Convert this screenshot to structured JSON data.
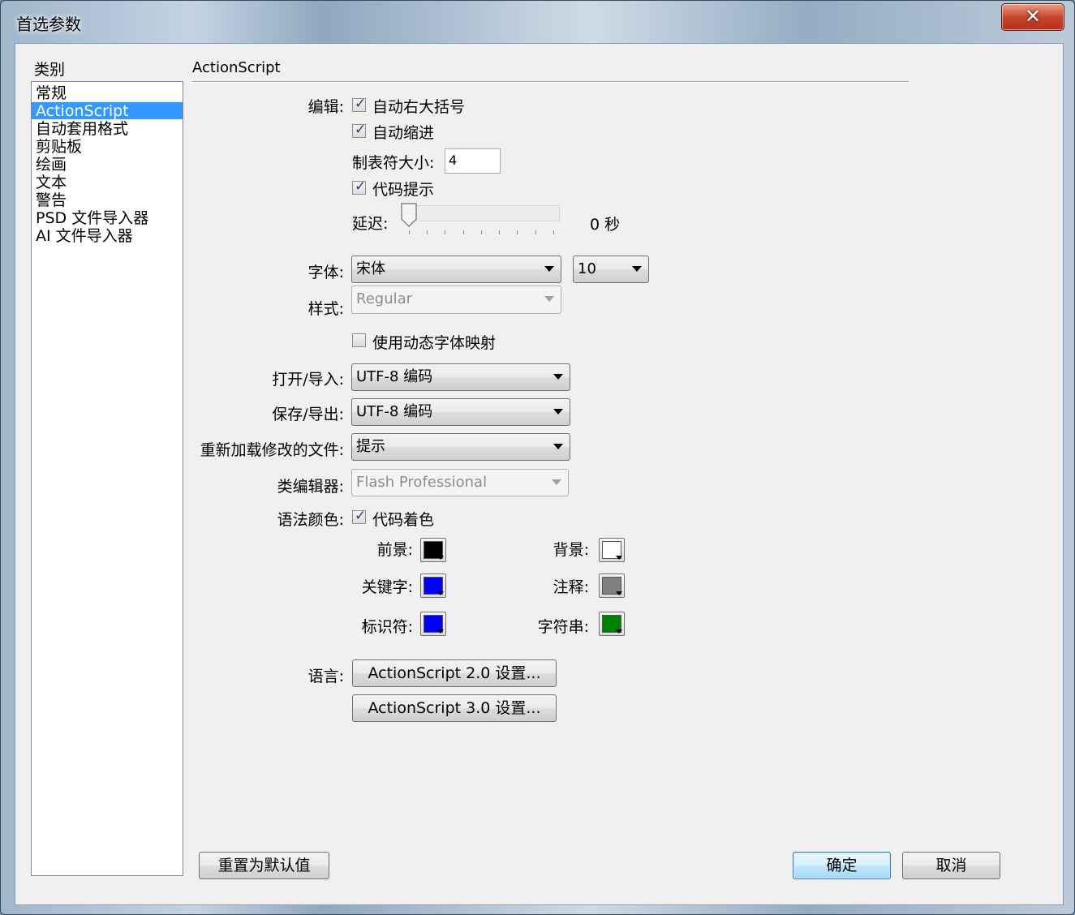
{
  "window": {
    "title": "首选参数",
    "close_glyph": "✕"
  },
  "categories": {
    "label": "类别",
    "items": [
      "常规",
      "ActionScript",
      "自动套用格式",
      "剪贴板",
      "绘画",
      "文本",
      "警告",
      "PSD 文件导入器",
      "AI 文件导入器"
    ],
    "selected": "ActionScript"
  },
  "section": {
    "title": "ActionScript"
  },
  "editing": {
    "label": "编辑:",
    "auto_brace": {
      "label": "自动右大括号",
      "checked": true
    },
    "auto_indent": {
      "label": "自动缩进",
      "checked": true
    },
    "tab_size_label": "制表符大小:",
    "tab_size_value": "4",
    "code_hints": {
      "label": "代码提示",
      "checked": true
    },
    "delay_label": "延迟:",
    "delay_value": "0 秒",
    "delay_level": 0
  },
  "font": {
    "label": "字体:",
    "family": "宋体",
    "size": "10",
    "style_label": "样式:",
    "style": "Regular",
    "dynamic_mapping": {
      "label": "使用动态字体映射",
      "checked": false
    }
  },
  "encoding": {
    "open_label": "打开/导入:",
    "open_value": "UTF-8 编码",
    "save_label": "保存/导出:",
    "save_value": "UTF-8 编码",
    "reload_label": "重新加载修改的文件:",
    "reload_value": "提示",
    "class_editor_label": "类编辑器:",
    "class_editor_value": "Flash Professional"
  },
  "syntax": {
    "label": "语法颜色:",
    "coloring": {
      "label": "代码着色",
      "checked": true
    },
    "foreground": {
      "label": "前景:",
      "color": "#000000"
    },
    "background": {
      "label": "背景:",
      "color": "#ffffff"
    },
    "keywords": {
      "label": "关键字:",
      "color": "#0000ff"
    },
    "comments": {
      "label": "注释:",
      "color": "#808080"
    },
    "identifiers": {
      "label": "标识符:",
      "color": "#0000ff"
    },
    "strings": {
      "label": "字符串:",
      "color": "#008000"
    }
  },
  "language": {
    "label": "语言:",
    "as2_button": "ActionScript 2.0 设置...",
    "as3_button": "ActionScript 3.0 设置..."
  },
  "footer": {
    "reset_button": "重置为默认值",
    "ok_button": "确定",
    "cancel_button": "取消"
  },
  "colors": {
    "selection": "#3399ff",
    "checkmark": "#2d3c73"
  }
}
